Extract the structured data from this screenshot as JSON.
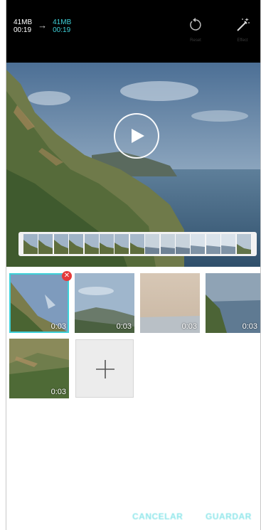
{
  "file_size": {
    "original_size": "41MB",
    "original_duration": "00:19",
    "new_size": "41MB",
    "new_duration": "00:19"
  },
  "toolbar": {
    "undo_label": "Reset",
    "effect_label": "Effect"
  },
  "clips": [
    {
      "duration": "0:03",
      "selected": true
    },
    {
      "duration": "0:03",
      "selected": false
    },
    {
      "duration": "0:03",
      "selected": false
    },
    {
      "duration": "0:03",
      "selected": false
    },
    {
      "duration": "0:03",
      "selected": false
    }
  ],
  "actions": {
    "cancel_label": "CANCELAR",
    "save_label": "GUARDAR"
  },
  "colors": {
    "accent": "#3ed0d8",
    "remove_badge": "#e53a3a",
    "topbar": "#000000"
  },
  "icons": {
    "undo": "undo-icon",
    "effect": "magic-wand-icon",
    "play": "play-icon",
    "add": "plus-icon",
    "remove": "close-icon"
  }
}
